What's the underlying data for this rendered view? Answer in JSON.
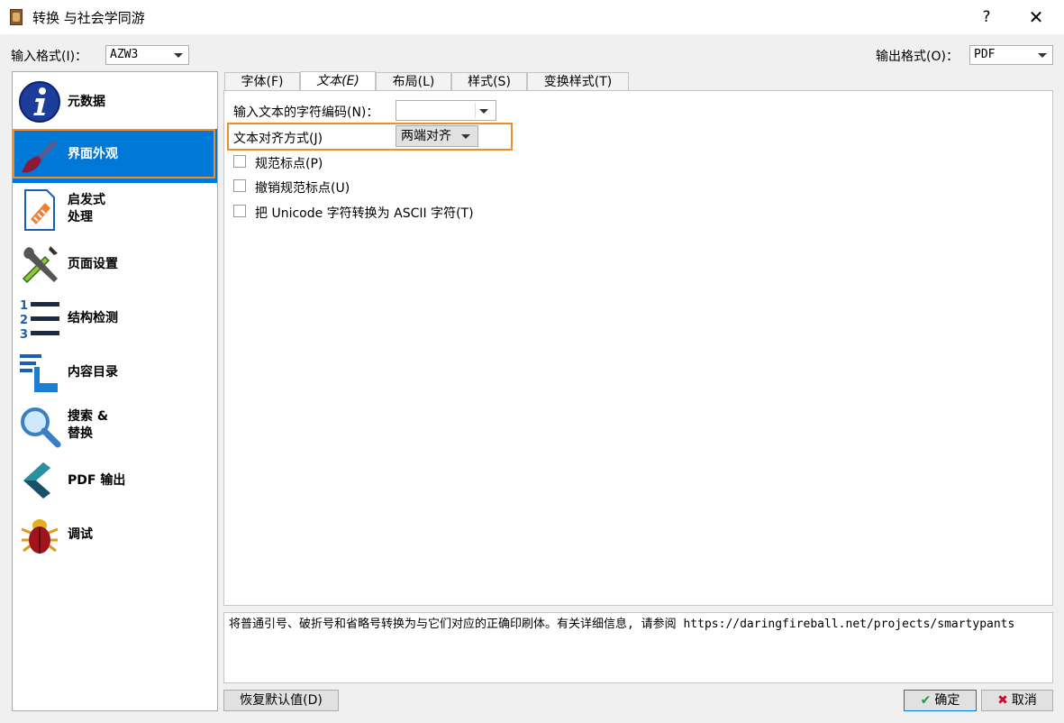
{
  "window": {
    "title": "转换 与社会学同游",
    "help_label": "?",
    "close_label": "✕"
  },
  "formats": {
    "input_label": "输入格式(I)：",
    "input_value": "AZW3",
    "output_label": "输出格式(O)：",
    "output_value": "PDF"
  },
  "sidebar": {
    "items": [
      {
        "label": "元数据",
        "icon": "info-icon"
      },
      {
        "label": "界面外观",
        "icon": "brush-icon"
      },
      {
        "label": "启发式\n处理",
        "icon": "heuristics-icon"
      },
      {
        "label": "页面设置",
        "icon": "page-setup-icon"
      },
      {
        "label": "结构检测",
        "icon": "structure-list-icon"
      },
      {
        "label": "内容目录",
        "icon": "toc-icon"
      },
      {
        "label": "搜索 &\n替换",
        "icon": "search-icon"
      },
      {
        "label": "PDF 输出",
        "icon": "pdf-output-icon"
      },
      {
        "label": "调试",
        "icon": "bug-icon"
      }
    ]
  },
  "tabs": [
    {
      "label": "字体(F)"
    },
    {
      "label": "文本(E)"
    },
    {
      "label": "布局(L)"
    },
    {
      "label": "样式(S)"
    },
    {
      "label": "变换样式(T)"
    }
  ],
  "text_tab": {
    "encoding_label": "输入文本的字符编码(N)：",
    "encoding_value": "",
    "alignment_label": "文本对齐方式(J)",
    "alignment_value": "两端对齐",
    "checkboxes": [
      {
        "label": "规范标点(P)",
        "checked": false
      },
      {
        "label": "撤销规范标点(U)",
        "checked": false
      },
      {
        "label": "把 Unicode 字符转换为 ASCII 字符(T)",
        "checked": false
      }
    ]
  },
  "description": "将普通引号、破折号和省略号转换为与它们对应的正确印刷体。有关详细信息, 请参阅 https://daringfireball.net/projects/smartypants",
  "buttons": {
    "restore": "恢复默认值(D)",
    "ok": "确定",
    "cancel": "取消"
  },
  "colors": {
    "selection": "#0078d7",
    "highlight": "#f28c28"
  }
}
